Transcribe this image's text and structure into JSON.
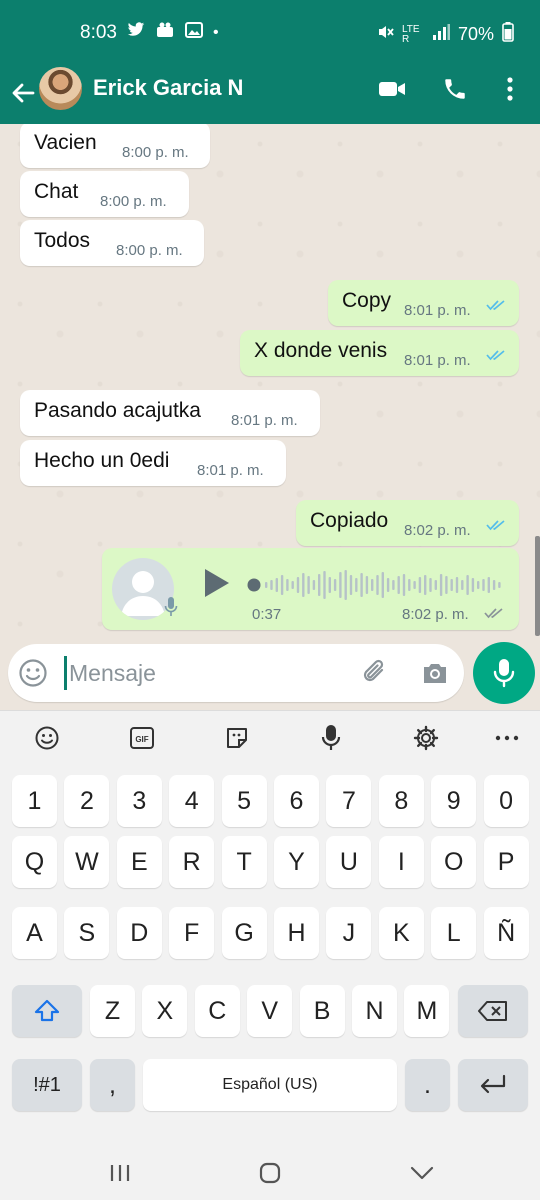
{
  "colors": {
    "header": "#0c7f6d",
    "outgoing": "#dcf8c6",
    "incoming": "#ffffff",
    "accent": "#00a884",
    "read_ticks": "#53bdeb"
  },
  "status_bar": {
    "time": "8:03",
    "network": "LTE R",
    "battery": "70%",
    "left_icons": [
      "twitter-icon",
      "teams-icon",
      "gallery-icon"
    ],
    "right_icons": [
      "mute-icon",
      "signal-icon",
      "battery-icon"
    ]
  },
  "header": {
    "contact_name": "Erick Garcia N",
    "icons": [
      "back-arrow-icon",
      "video-call-icon",
      "phone-icon",
      "more-options-icon"
    ]
  },
  "messages": [
    {
      "direction": "in",
      "text": "Vacien",
      "time": "8:00 p. m."
    },
    {
      "direction": "in",
      "text": "Chat",
      "time": "8:00 p. m."
    },
    {
      "direction": "in",
      "text": "Todos",
      "time": "8:00 p. m."
    },
    {
      "direction": "out",
      "text": "Copy",
      "time": "8:01 p. m.",
      "status": "read"
    },
    {
      "direction": "out",
      "text": "X donde venis",
      "time": "8:01 p. m.",
      "status": "read"
    },
    {
      "direction": "in",
      "text": "Pasando acajutka",
      "time": "8:01 p. m."
    },
    {
      "direction": "in",
      "text": "Hecho un 0edi",
      "time": "8:01 p. m."
    },
    {
      "direction": "out",
      "text": "Copiado",
      "time": "8:02 p. m.",
      "status": "read"
    }
  ],
  "voice_note": {
    "duration": "0:37",
    "time": "8:02 p. m.",
    "status": "delivered",
    "progress": 0
  },
  "composer": {
    "placeholder": "Mensaje",
    "value": ""
  },
  "keyboard": {
    "toolbar": [
      "emoji-icon",
      "gif-icon",
      "sticker-icon",
      "voice-input-icon",
      "settings-icon",
      "more-icon"
    ],
    "gif_label": "GIF",
    "rows": [
      [
        "1",
        "2",
        "3",
        "4",
        "5",
        "6",
        "7",
        "8",
        "9",
        "0"
      ],
      [
        "Q",
        "W",
        "E",
        "R",
        "T",
        "Y",
        "U",
        "I",
        "O",
        "P"
      ],
      [
        "A",
        "S",
        "D",
        "F",
        "G",
        "H",
        "J",
        "K",
        "L",
        "Ñ"
      ],
      [
        "Z",
        "X",
        "C",
        "V",
        "B",
        "N",
        "M"
      ]
    ],
    "symbols_label": "!#1",
    "comma_label": ",",
    "space_label": "Español (US)",
    "period_label": "."
  },
  "nav_bar": [
    "recents-icon",
    "home-icon",
    "back-icon"
  ]
}
